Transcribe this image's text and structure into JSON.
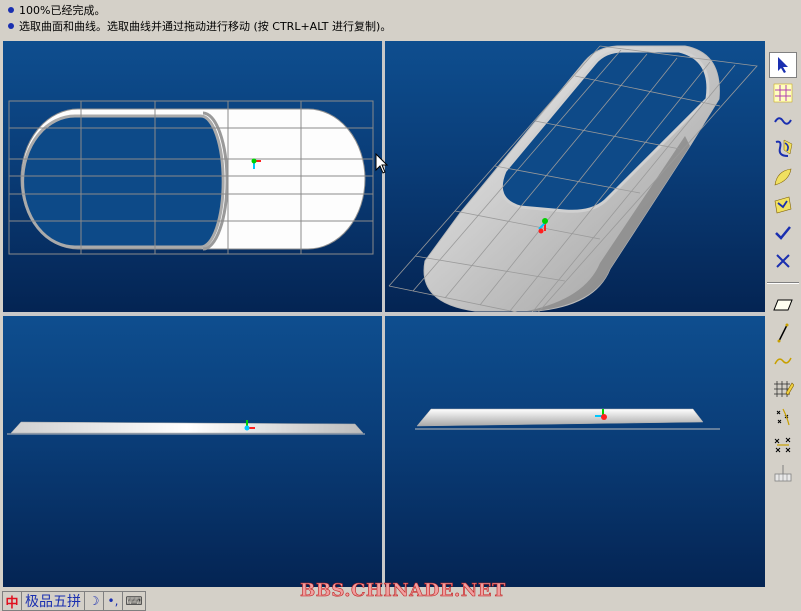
{
  "status": {
    "line1": "100%已经完成。",
    "line2": "选取曲面和曲线。选取曲线并通过拖动进行移动 (按 CTRL+ALT 进行复制)。"
  },
  "viewports": [
    {
      "name": "top-view"
    },
    {
      "name": "perspective-view"
    },
    {
      "name": "front-view"
    },
    {
      "name": "right-view"
    }
  ],
  "toolbar": {
    "tools": [
      {
        "icon": "select-arrow-icon",
        "active": true
      },
      {
        "icon": "grid-points-icon",
        "active": false
      },
      {
        "icon": "curve-wave-icon",
        "active": false
      },
      {
        "icon": "curve-edit-icon",
        "active": false
      },
      {
        "icon": "surface-patch-icon",
        "active": false
      },
      {
        "icon": "surface-edit-icon",
        "active": false
      },
      {
        "icon": "checkmark-icon",
        "active": false
      },
      {
        "icon": "cancel-x-icon",
        "active": false
      },
      {
        "icon": "plane-icon",
        "active": false
      },
      {
        "icon": "line-icon",
        "active": false
      },
      {
        "icon": "spline-icon",
        "active": false
      },
      {
        "icon": "grid-edit-icon",
        "active": false
      },
      {
        "icon": "points-scatter-icon",
        "active": false
      },
      {
        "icon": "points-cross-icon",
        "active": false
      },
      {
        "icon": "base-plane-icon",
        "active": false
      }
    ]
  },
  "taskbar": {
    "ime_lang": "中",
    "ime_name": "极品五拼",
    "moon_symbol": "☽",
    "punct_symbol": "•,",
    "keyboard_symbol": "⌨"
  },
  "watermark": "BBS.CHINADE.NET",
  "colors": {
    "viewport_top": "#0e4e8f",
    "viewport_bottom": "#042453",
    "accent_blue": "#1a2fb0",
    "watermark_red": "#c02020"
  }
}
